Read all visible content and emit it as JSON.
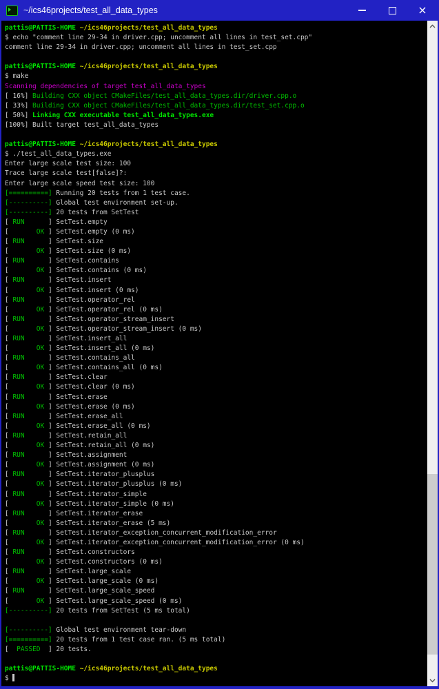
{
  "window": {
    "title": "~/ics46projects/test_all_data_types",
    "close_glyph": "×",
    "icons": [
      "terminal-app-icon",
      "minimize-icon",
      "maximize-icon",
      "close-icon",
      "scroll-up-icon",
      "scroll-down-icon"
    ]
  },
  "colors": {
    "w": {
      "hex": "#c9c9c9"
    },
    "g": {
      "hex": "#00bd00"
    },
    "gb": {
      "hex": "#00e400",
      "bold": true
    },
    "yb": {
      "hex": "#cbcb00",
      "bold": true
    },
    "m": {
      "hex": "#cc00cc"
    },
    "titlebar": {
      "hex": "#2222c4"
    },
    "background": {
      "hex": "#000000"
    },
    "scroll_track": {
      "hex": "#f0f0f0"
    },
    "scroll_thumb": {
      "hex": "#cdcdcd"
    }
  },
  "terminal": {
    "lines": [
      [
        [
          "gb",
          "pattis@PATTIS-HOME"
        ],
        [
          "w",
          " "
        ],
        [
          "yb",
          "~/ics46projects/test_all_data_types"
        ]
      ],
      [
        [
          "w",
          "$ echo \"comment line 29-34 in driver.cpp; uncomment all lines in test_set.cpp\""
        ]
      ],
      [
        [
          "w",
          "comment line 29-34 in driver.cpp; uncomment all lines in test_set.cpp"
        ]
      ],
      [],
      [
        [
          "gb",
          "pattis@PATTIS-HOME"
        ],
        [
          "w",
          " "
        ],
        [
          "yb",
          "~/ics46projects/test_all_data_types"
        ]
      ],
      [
        [
          "w",
          "$ make"
        ]
      ],
      [
        [
          "m",
          "Scanning dependencies of target test_all_data_types"
        ]
      ],
      [
        [
          "w",
          "[ 16%] "
        ],
        [
          "g",
          "Building CXX object CMakeFiles/test_all_data_types.dir/driver.cpp.o"
        ]
      ],
      [
        [
          "w",
          "[ 33%] "
        ],
        [
          "g",
          "Building CXX object CMakeFiles/test_all_data_types.dir/test_set.cpp.o"
        ]
      ],
      [
        [
          "w",
          "[ 50%] "
        ],
        [
          "gb",
          "Linking CXX executable test_all_data_types.exe"
        ]
      ],
      [
        [
          "w",
          "[100%] Built target test_all_data_types"
        ]
      ],
      [],
      [
        [
          "gb",
          "pattis@PATTIS-HOME"
        ],
        [
          "w",
          " "
        ],
        [
          "yb",
          "~/ics46projects/test_all_data_types"
        ]
      ],
      [
        [
          "w",
          "$ ./test_all_data_types.exe"
        ]
      ],
      [
        [
          "w",
          "Enter large scale test size: 100"
        ]
      ],
      [
        [
          "w",
          "Trace large scale test[false]?:"
        ]
      ],
      [
        [
          "w",
          "Enter large scale speed test size: 100"
        ]
      ],
      [
        [
          "g",
          "[==========]"
        ],
        [
          "w",
          " Running 20 tests from 1 test case."
        ]
      ],
      [
        [
          "g",
          "[----------]"
        ],
        [
          "w",
          " Global test environment set-up."
        ]
      ],
      [
        [
          "g",
          "[----------]"
        ],
        [
          "w",
          " 20 tests from SetTest"
        ]
      ],
      [
        [
          "w",
          "[ "
        ],
        [
          "g",
          "RUN"
        ],
        [
          "w",
          "      ] SetTest.empty"
        ]
      ],
      [
        [
          "w",
          "[       "
        ],
        [
          "g",
          "OK"
        ],
        [
          "w",
          " ] SetTest.empty (0 ms)"
        ]
      ],
      [
        [
          "w",
          "[ "
        ],
        [
          "g",
          "RUN"
        ],
        [
          "w",
          "      ] SetTest.size"
        ]
      ],
      [
        [
          "w",
          "[       "
        ],
        [
          "g",
          "OK"
        ],
        [
          "w",
          " ] SetTest.size (0 ms)"
        ]
      ],
      [
        [
          "w",
          "[ "
        ],
        [
          "g",
          "RUN"
        ],
        [
          "w",
          "      ] SetTest.contains"
        ]
      ],
      [
        [
          "w",
          "[       "
        ],
        [
          "g",
          "OK"
        ],
        [
          "w",
          " ] SetTest.contains (0 ms)"
        ]
      ],
      [
        [
          "w",
          "[ "
        ],
        [
          "g",
          "RUN"
        ],
        [
          "w",
          "      ] SetTest.insert"
        ]
      ],
      [
        [
          "w",
          "[       "
        ],
        [
          "g",
          "OK"
        ],
        [
          "w",
          " ] SetTest.insert (0 ms)"
        ]
      ],
      [
        [
          "w",
          "[ "
        ],
        [
          "g",
          "RUN"
        ],
        [
          "w",
          "      ] SetTest.operator_rel"
        ]
      ],
      [
        [
          "w",
          "[       "
        ],
        [
          "g",
          "OK"
        ],
        [
          "w",
          " ] SetTest.operator_rel (0 ms)"
        ]
      ],
      [
        [
          "w",
          "[ "
        ],
        [
          "g",
          "RUN"
        ],
        [
          "w",
          "      ] SetTest.operator_stream_insert"
        ]
      ],
      [
        [
          "w",
          "[       "
        ],
        [
          "g",
          "OK"
        ],
        [
          "w",
          " ] SetTest.operator_stream_insert (0 ms)"
        ]
      ],
      [
        [
          "w",
          "[ "
        ],
        [
          "g",
          "RUN"
        ],
        [
          "w",
          "      ] SetTest.insert_all"
        ]
      ],
      [
        [
          "w",
          "[       "
        ],
        [
          "g",
          "OK"
        ],
        [
          "w",
          " ] SetTest.insert_all (0 ms)"
        ]
      ],
      [
        [
          "w",
          "[ "
        ],
        [
          "g",
          "RUN"
        ],
        [
          "w",
          "      ] SetTest.contains_all"
        ]
      ],
      [
        [
          "w",
          "[       "
        ],
        [
          "g",
          "OK"
        ],
        [
          "w",
          " ] SetTest.contains_all (0 ms)"
        ]
      ],
      [
        [
          "w",
          "[ "
        ],
        [
          "g",
          "RUN"
        ],
        [
          "w",
          "      ] SetTest.clear"
        ]
      ],
      [
        [
          "w",
          "[       "
        ],
        [
          "g",
          "OK"
        ],
        [
          "w",
          " ] SetTest.clear (0 ms)"
        ]
      ],
      [
        [
          "w",
          "[ "
        ],
        [
          "g",
          "RUN"
        ],
        [
          "w",
          "      ] SetTest.erase"
        ]
      ],
      [
        [
          "w",
          "[       "
        ],
        [
          "g",
          "OK"
        ],
        [
          "w",
          " ] SetTest.erase (0 ms)"
        ]
      ],
      [
        [
          "w",
          "[ "
        ],
        [
          "g",
          "RUN"
        ],
        [
          "w",
          "      ] SetTest.erase_all"
        ]
      ],
      [
        [
          "w",
          "[       "
        ],
        [
          "g",
          "OK"
        ],
        [
          "w",
          " ] SetTest.erase_all (0 ms)"
        ]
      ],
      [
        [
          "w",
          "[ "
        ],
        [
          "g",
          "RUN"
        ],
        [
          "w",
          "      ] SetTest.retain_all"
        ]
      ],
      [
        [
          "w",
          "[       "
        ],
        [
          "g",
          "OK"
        ],
        [
          "w",
          " ] SetTest.retain_all (0 ms)"
        ]
      ],
      [
        [
          "w",
          "[ "
        ],
        [
          "g",
          "RUN"
        ],
        [
          "w",
          "      ] SetTest.assignment"
        ]
      ],
      [
        [
          "w",
          "[       "
        ],
        [
          "g",
          "OK"
        ],
        [
          "w",
          " ] SetTest.assignment (0 ms)"
        ]
      ],
      [
        [
          "w",
          "[ "
        ],
        [
          "g",
          "RUN"
        ],
        [
          "w",
          "      ] SetTest.iterator_plusplus"
        ]
      ],
      [
        [
          "w",
          "[       "
        ],
        [
          "g",
          "OK"
        ],
        [
          "w",
          " ] SetTest.iterator_plusplus (0 ms)"
        ]
      ],
      [
        [
          "w",
          "[ "
        ],
        [
          "g",
          "RUN"
        ],
        [
          "w",
          "      ] SetTest.iterator_simple"
        ]
      ],
      [
        [
          "w",
          "[       "
        ],
        [
          "g",
          "OK"
        ],
        [
          "w",
          " ] SetTest.iterator_simple (0 ms)"
        ]
      ],
      [
        [
          "w",
          "[ "
        ],
        [
          "g",
          "RUN"
        ],
        [
          "w",
          "      ] SetTest.iterator_erase"
        ]
      ],
      [
        [
          "w",
          "[       "
        ],
        [
          "g",
          "OK"
        ],
        [
          "w",
          " ] SetTest.iterator_erase (5 ms)"
        ]
      ],
      [
        [
          "w",
          "[ "
        ],
        [
          "g",
          "RUN"
        ],
        [
          "w",
          "      ] SetTest.iterator_exception_concurrent_modification_error"
        ]
      ],
      [
        [
          "w",
          "[       "
        ],
        [
          "g",
          "OK"
        ],
        [
          "w",
          " ] SetTest.iterator_exception_concurrent_modification_error (0 ms)"
        ]
      ],
      [
        [
          "w",
          "[ "
        ],
        [
          "g",
          "RUN"
        ],
        [
          "w",
          "      ] SetTest.constructors"
        ]
      ],
      [
        [
          "w",
          "[       "
        ],
        [
          "g",
          "OK"
        ],
        [
          "w",
          " ] SetTest.constructors (0 ms)"
        ]
      ],
      [
        [
          "w",
          "[ "
        ],
        [
          "g",
          "RUN"
        ],
        [
          "w",
          "      ] SetTest.large_scale"
        ]
      ],
      [
        [
          "w",
          "[       "
        ],
        [
          "g",
          "OK"
        ],
        [
          "w",
          " ] SetTest.large_scale (0 ms)"
        ]
      ],
      [
        [
          "w",
          "[ "
        ],
        [
          "g",
          "RUN"
        ],
        [
          "w",
          "      ] SetTest.large_scale_speed"
        ]
      ],
      [
        [
          "w",
          "[       "
        ],
        [
          "g",
          "OK"
        ],
        [
          "w",
          " ] SetTest.large_scale_speed (0 ms)"
        ]
      ],
      [
        [
          "g",
          "[----------]"
        ],
        [
          "w",
          " 20 tests from SetTest (5 ms total)"
        ]
      ],
      [],
      [
        [
          "g",
          "[----------]"
        ],
        [
          "w",
          " Global test environment tear-down"
        ]
      ],
      [
        [
          "g",
          "[==========]"
        ],
        [
          "w",
          " 20 tests from 1 test case ran. (5 ms total)"
        ]
      ],
      [
        [
          "w",
          "[  "
        ],
        [
          "g",
          "PASSED"
        ],
        [
          "w",
          "  ] 20 tests."
        ]
      ],
      [],
      [
        [
          "gb",
          "pattis@PATTIS-HOME"
        ],
        [
          "w",
          " "
        ],
        [
          "yb",
          "~/ics46projects/test_all_data_types"
        ]
      ],
      [
        [
          "w",
          "$ "
        ],
        [
          "cursor",
          ""
        ]
      ]
    ]
  }
}
